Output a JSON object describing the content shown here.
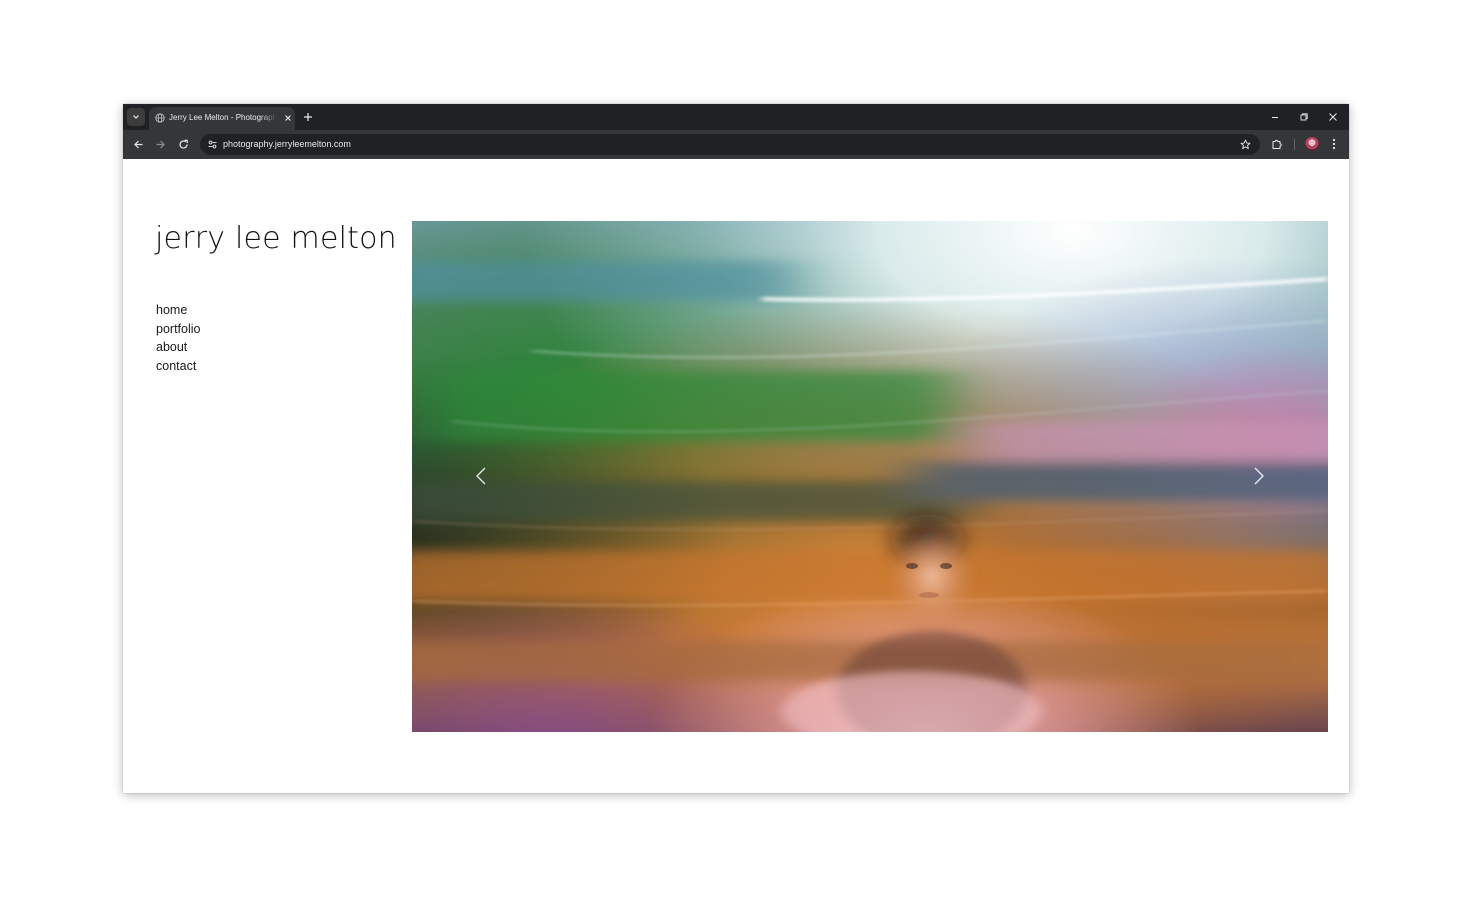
{
  "browser": {
    "tab_title": "Jerry Lee Melton - Photographer",
    "url": "photography.jerryleemelton.com"
  },
  "site": {
    "title": "jerry lee melton",
    "nav": [
      {
        "label": "home"
      },
      {
        "label": "portfolio"
      },
      {
        "label": "about"
      },
      {
        "label": "contact"
      }
    ]
  },
  "slideshow": {
    "prev_icon": "chevron-left-icon",
    "next_icon": "chevron-right-icon"
  },
  "colors": {
    "browser_frame": "#202124",
    "browser_toolbar": "#35363a",
    "page_background": "#ffffff",
    "text": "#111111"
  }
}
